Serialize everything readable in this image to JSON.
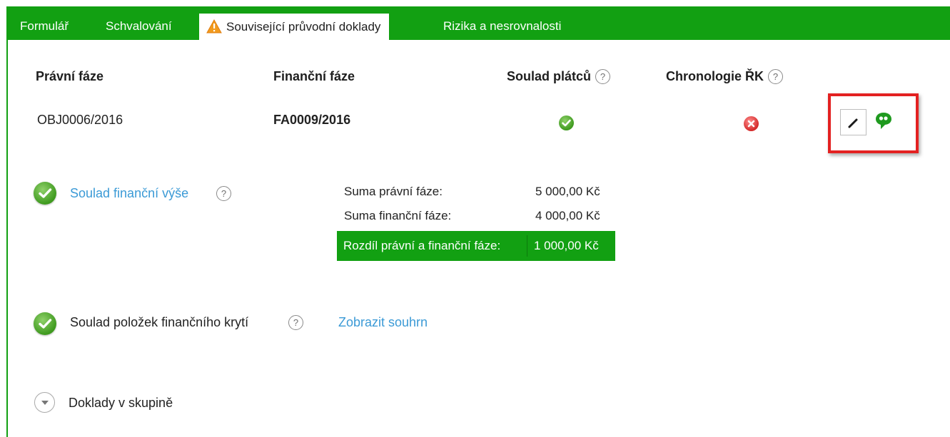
{
  "tabs": [
    {
      "label": "Formulář",
      "active": false
    },
    {
      "label": "Schvalování",
      "active": false
    },
    {
      "label": "Související průvodní doklady",
      "active": true,
      "icon": "warning-icon"
    },
    {
      "label": "Rizika a nesrovnalosti",
      "active": false
    }
  ],
  "table": {
    "headers": {
      "legal_phase": "Právní fáze",
      "financial_phase": "Finanční fáze",
      "payer_match": "Soulad plátců",
      "chronology": "Chronologie ŘK"
    },
    "help_glyph": "?",
    "row": {
      "legal_phase": "OBJ0006/2016",
      "financial_phase": "FA0009/2016",
      "payer_match_status": "ok",
      "chronology_status": "error",
      "actions": [
        "edit-icon",
        "comment-icon"
      ]
    }
  },
  "amount_check": {
    "status": "ok",
    "link_label": "Soulad finanční výše",
    "rows": [
      {
        "label": "Suma právní fáze:",
        "value": "5 000,00 Kč"
      },
      {
        "label": "Suma finanční fáze:",
        "value": "4 000,00 Kč"
      }
    ],
    "difference": {
      "label": "Rozdíl právní a finanční fáze:",
      "value": "1 000,00 Kč"
    }
  },
  "items_check": {
    "status": "ok",
    "label": "Soulad položek finančního krytí",
    "link_label": "Zobrazit souhrn"
  },
  "group_docs": {
    "label": "Doklady v skupině",
    "icon": "chevron-down-icon"
  },
  "colors": {
    "accent_green": "#12a012",
    "link_blue": "#3b9ad6",
    "highlight_red": "#e32121",
    "error_red": "#d42a2a"
  }
}
